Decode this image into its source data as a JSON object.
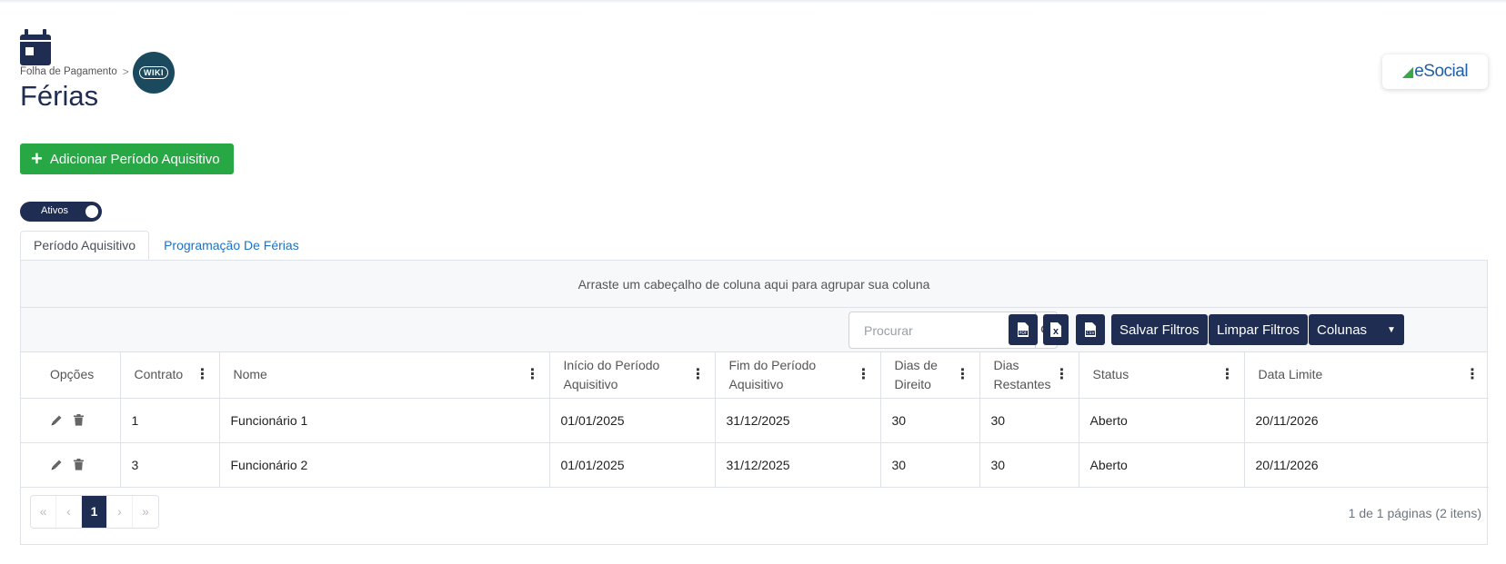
{
  "header": {
    "breadcrumb": "Folha de Pagamento",
    "breadcrumb_sep": ">",
    "wiki_label": "WIKI",
    "title": "Férias",
    "esocial_label": "eSocial"
  },
  "actions": {
    "add_label": "Adicionar Período Aquisitivo",
    "toggle_label": "Ativos"
  },
  "tabs": [
    {
      "label": "Período Aquisitivo",
      "active": true
    },
    {
      "label": "Programação De Férias",
      "active": false
    }
  ],
  "grid": {
    "group_hint": "Arraste um cabeçalho de coluna aqui para agrupar sua coluna",
    "toolbar": {
      "search_placeholder": "Procurar",
      "search_value": "",
      "pdf_icon": "pdf-icon",
      "excel_icon": "excel-icon",
      "csv_icon": "csv-icon",
      "save_filters": "Salvar Filtros",
      "clear_filters": "Limpar Filtros",
      "columns": "Colunas"
    },
    "columns": [
      "Opções",
      "Contrato",
      "Nome",
      "Início do Período Aquisitivo",
      "Fim do Período Aquisitivo",
      "Dias de Direito",
      "Dias Restantes",
      "Status",
      "Data Limite"
    ],
    "rows": [
      {
        "contrato": "1",
        "nome": "Funcionário 1",
        "inicio": "01/01/2025",
        "fim": "31/12/2025",
        "direito": "30",
        "restantes": "30",
        "status": "Aberto",
        "limite": "20/11/2026"
      },
      {
        "contrato": "3",
        "nome": "Funcionário 2",
        "inicio": "01/01/2025",
        "fim": "31/12/2025",
        "direito": "30",
        "restantes": "30",
        "status": "Aberto",
        "limite": "20/11/2026"
      }
    ],
    "pager": {
      "first": "«",
      "prev": "‹",
      "current": "1",
      "next": "›",
      "last": "»",
      "info": "1 de 1 páginas (2 itens)"
    }
  },
  "colors": {
    "primary": "#1f2d52",
    "success": "#28a745",
    "link": "#1a73c8"
  }
}
